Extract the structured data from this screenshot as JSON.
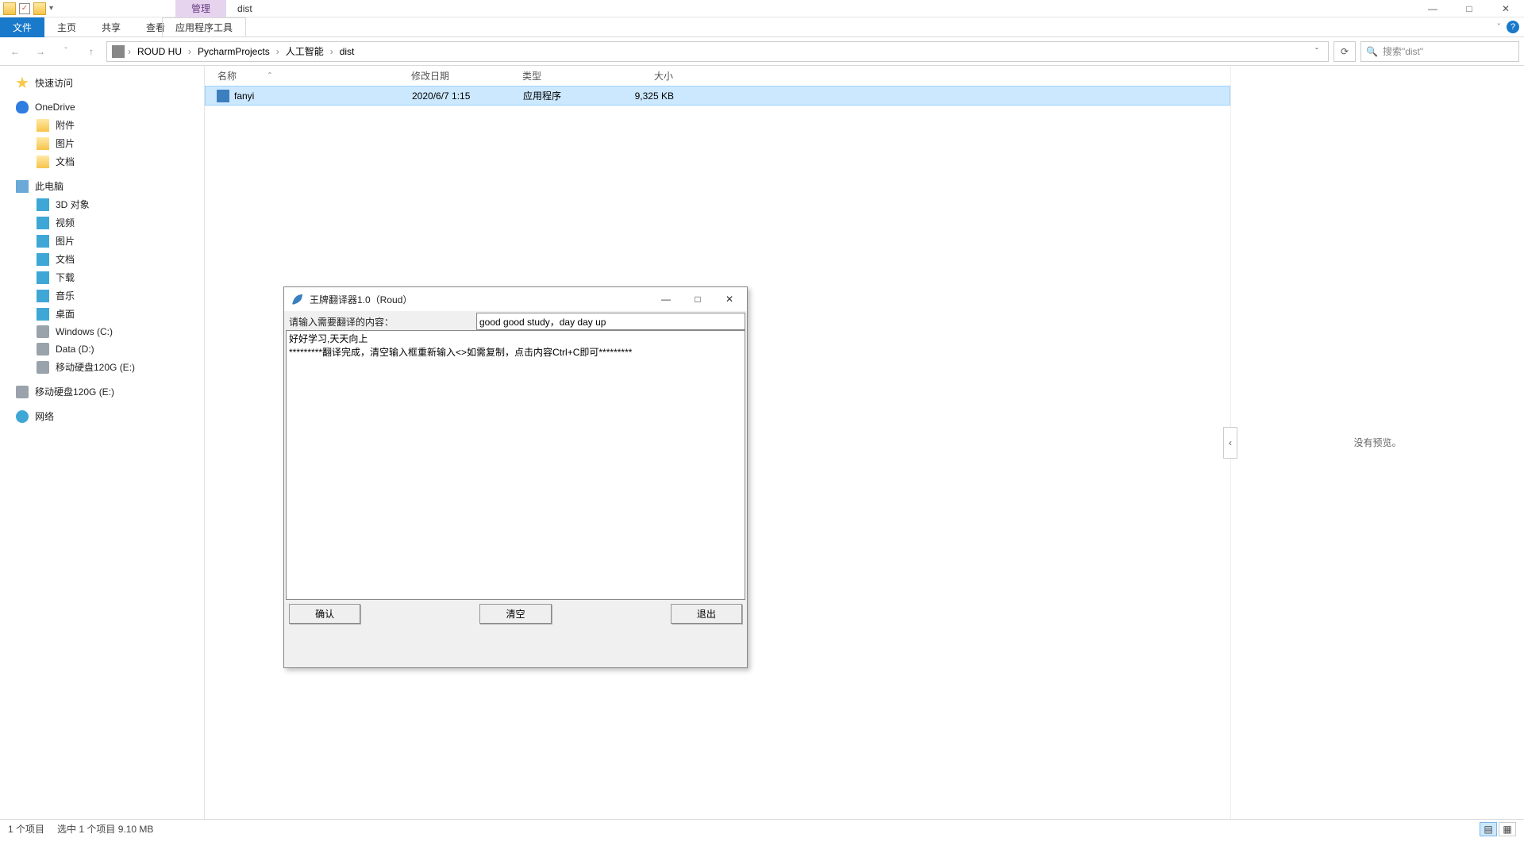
{
  "window": {
    "contextual_label": "管理",
    "title": "dist",
    "minimize": "—",
    "maximize": "□",
    "close": "✕"
  },
  "ribbon": {
    "file": "文件",
    "home": "主页",
    "share": "共享",
    "view": "查看",
    "apptools": "应用程序工具",
    "expand": "ˇ",
    "help": "?"
  },
  "nav": {
    "back": "←",
    "forward": "→",
    "up": "↑",
    "segments": [
      "ROUD HU",
      "PycharmProjects",
      "人工智能",
      "dist"
    ],
    "sep": "›",
    "dropdown": "ˇ",
    "refresh": "⟳",
    "search_placeholder": "搜索\"dist\"",
    "search_icon": "🔍"
  },
  "sidebar": {
    "quick": "快速访问",
    "onedrive": "OneDrive",
    "onedrive_items": [
      "附件",
      "图片",
      "文档"
    ],
    "thispc": "此电脑",
    "pc_items": [
      "3D 对象",
      "视频",
      "图片",
      "文档",
      "下载",
      "音乐",
      "桌面",
      "Windows (C:)",
      "Data (D:)",
      "移动硬盘120G (E:)"
    ],
    "drive_ext": "移动硬盘120G (E:)",
    "network": "网络"
  },
  "columns": {
    "name": "名称",
    "sort": "ˆ",
    "date": "修改日期",
    "type": "类型",
    "size": "大小"
  },
  "files": [
    {
      "name": "fanyi",
      "date": "2020/6/7 1:15",
      "type": "应用程序",
      "size": "9,325 KB"
    }
  ],
  "preview": {
    "collapse": "‹",
    "text": "没有预览。"
  },
  "status": {
    "count": "1 个项目",
    "selected": "选中 1 个项目  9.10 MB"
  },
  "modal": {
    "title": "王牌翻译器1.0（Roud）",
    "min": "—",
    "max": "□",
    "close": "✕",
    "input_label": "请输入需要翻译的内容：",
    "input_value": "good good study，day day up",
    "output_text": "好好学习,天天向上\n*********翻译完成，清空输入框重新输入<>如需复制，点击内容Ctrl+C即可*********",
    "btn_ok": "确认",
    "btn_clear": "清空",
    "btn_exit": "退出"
  }
}
